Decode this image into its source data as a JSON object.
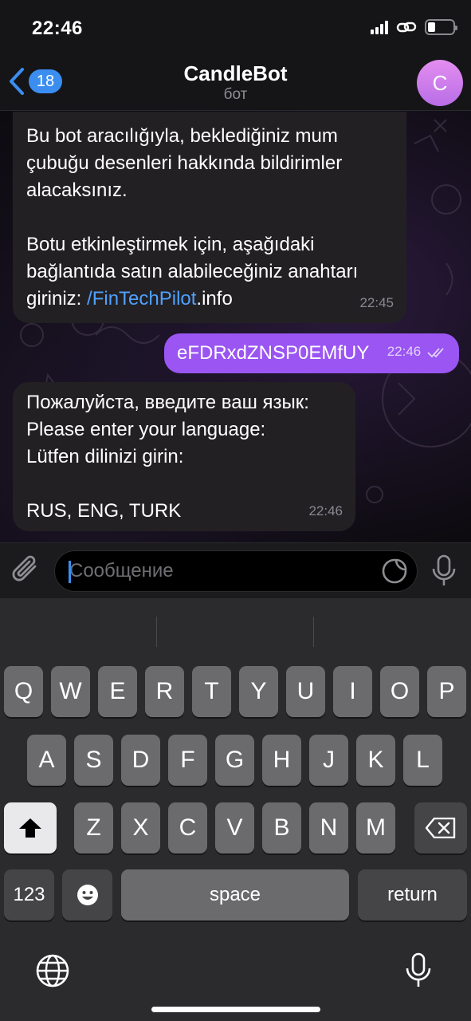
{
  "status_bar": {
    "time": "22:46"
  },
  "header": {
    "back_count": "18",
    "title": "CandleBot",
    "subtitle": "бот",
    "avatar_letter": "C",
    "avatar_color": "#d580ee"
  },
  "messages": [
    {
      "direction": "incoming",
      "text_before_link": "Bu bot aracılığıyla, beklediğiniz mum\nçubuğu desenleri hakkında bildirimler\nalacaksınız.\n\nBotu etkinleştirmek için, aşağıdaki\nbağlantıda satın alabileceğiniz anahtarı\ngiriniz: ",
      "link_text": "/FinTechPilot",
      "text_after_link": ".info",
      "time": "22:45"
    },
    {
      "direction": "outgoing",
      "text": "eFDRxdZNSP0EMfUY",
      "time": "22:46",
      "read": true
    },
    {
      "direction": "incoming",
      "text": "Пожалуйста, введите ваш язык:\nPlease enter your language:\nLütfen dilinizi girin:\n\nRUS, ENG, TURK",
      "time": "22:46"
    }
  ],
  "composer": {
    "placeholder": "Сообщение"
  },
  "keyboard": {
    "row1": [
      "Q",
      "W",
      "E",
      "R",
      "T",
      "Y",
      "U",
      "I",
      "O",
      "P"
    ],
    "row2": [
      "A",
      "S",
      "D",
      "F",
      "G",
      "H",
      "J",
      "K",
      "L"
    ],
    "row3": [
      "Z",
      "X",
      "C",
      "V",
      "B",
      "N",
      "M"
    ],
    "numbers_key": "123",
    "space_key": "space",
    "return_key": "return"
  },
  "colors": {
    "accent": "#3b8ef0",
    "outgoing_bubble": "#9a55f2",
    "incoming_bubble": "#232024",
    "link": "#4fa1ff"
  }
}
